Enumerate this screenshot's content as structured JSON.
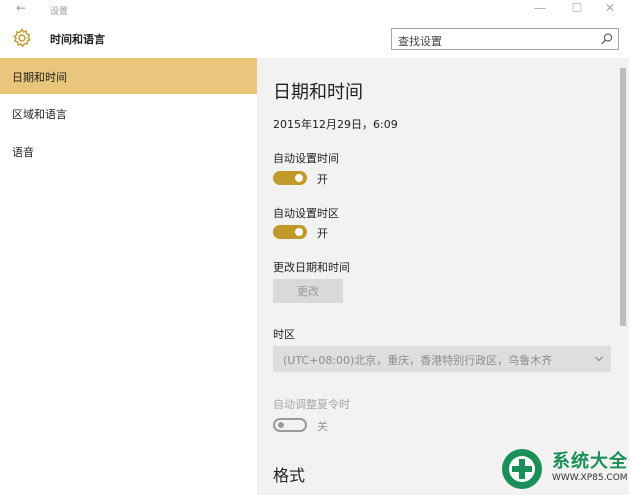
{
  "window": {
    "back_glyph": "←",
    "title": "设置",
    "minimize_glyph": "—",
    "maximize_glyph": "☐",
    "close_glyph": "✕"
  },
  "header": {
    "title": "时间和语言",
    "search_placeholder": "查找设置"
  },
  "sidebar": {
    "items": [
      {
        "label": "日期和时间",
        "selected": true
      },
      {
        "label": "区域和语言",
        "selected": false
      },
      {
        "label": "语音",
        "selected": false
      }
    ]
  },
  "main": {
    "title": "日期和时间",
    "current_datetime": "2015年12月29日，6:09",
    "auto_time": {
      "label": "自动设置时间",
      "state": "开",
      "on": true
    },
    "auto_timezone": {
      "label": "自动设置时区",
      "state": "开",
      "on": true
    },
    "change_datetime": {
      "label": "更改日期和时间",
      "button": "更改"
    },
    "timezone": {
      "label": "时区",
      "value": "(UTC+08:00)北京，重庆，香港特别行政区，乌鲁木齐"
    },
    "dst": {
      "label": "自动调整夏令时",
      "state": "关",
      "on": false
    },
    "format_section": "格式"
  },
  "watermark": {
    "brand": "系统大全",
    "url": "WWW.XP85.COM"
  },
  "colors": {
    "accent": "#c29a2c",
    "selected_bg": "#e8c67b",
    "content_bg": "#f2f2f2"
  },
  "icons": {
    "header": "gear-icon",
    "search": "search-icon",
    "timezone_dropdown": "chevron-down-icon"
  }
}
